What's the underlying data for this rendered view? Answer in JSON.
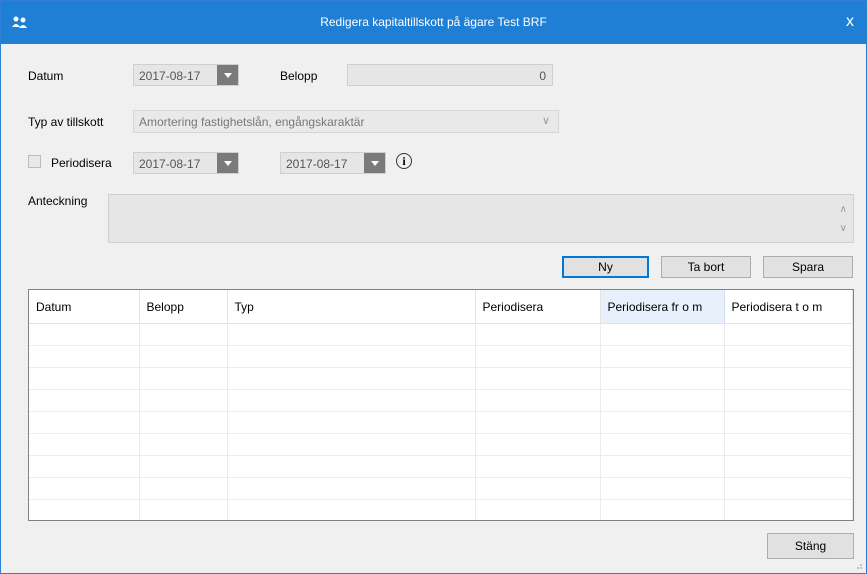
{
  "window": {
    "title": "Redigera kapitaltillskott på ägare Test BRF",
    "close_glyph": "x",
    "app_icon": "users-icon"
  },
  "form": {
    "datum_label": "Datum",
    "datum_value": "2017-08-17",
    "belopp_label": "Belopp",
    "belopp_value": "0",
    "typ_label": "Typ av tillskott",
    "typ_value": "Amortering fastighetslån, engångskaraktär",
    "periodisera_label": "Periodisera",
    "periodisera_checked": false,
    "period_from": "2017-08-17",
    "period_to": "2017-08-17",
    "info_glyph": "i",
    "anteckning_label": "Anteckning",
    "anteckning_value": ""
  },
  "buttons": {
    "ny": "Ny",
    "ta_bort": "Ta bort",
    "spara": "Spara",
    "stang": "Stäng"
  },
  "table": {
    "columns": [
      "Datum",
      "Belopp",
      "Typ",
      "Periodisera",
      "Periodisera fr o m",
      "Periodisera t o m"
    ],
    "rows": []
  },
  "colors": {
    "titlebar": "#1e7fd4",
    "primary_border": "#0078d7"
  }
}
